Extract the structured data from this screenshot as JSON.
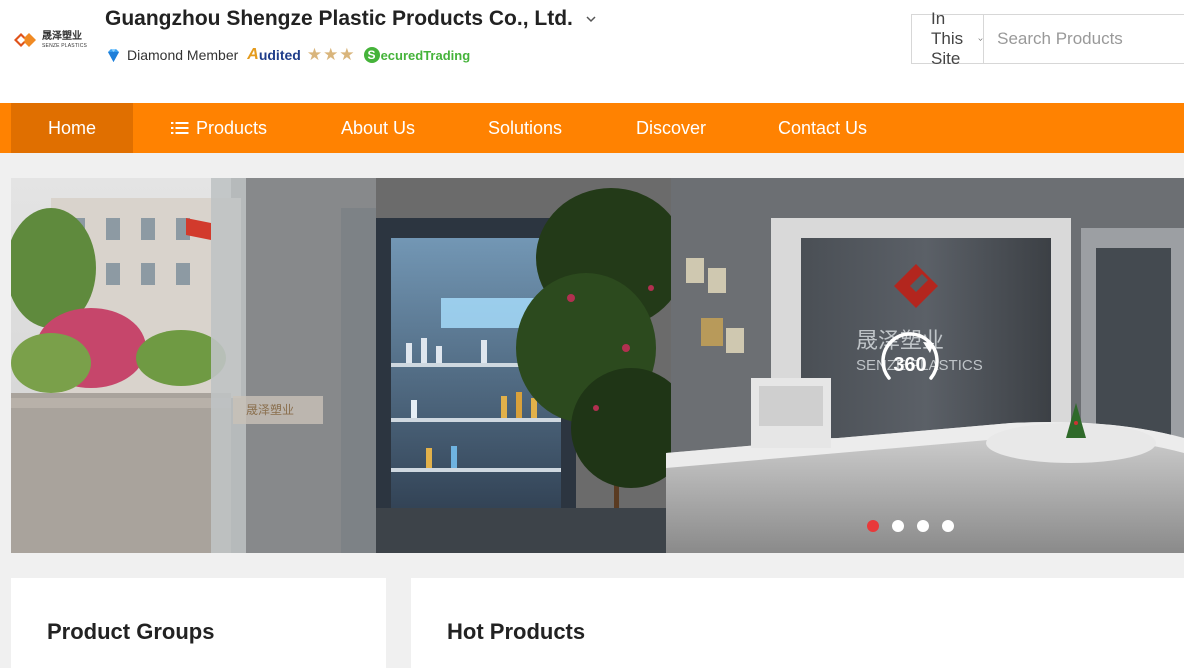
{
  "header": {
    "company_name": "Guangzhou Shengze Plastic Products Co., Ltd.",
    "logo_cn": "晟泽塑业",
    "logo_en": "SENZE PLASTICS",
    "membership": "Diamond Member",
    "audited_initial": "A",
    "audited_rest": "udited",
    "stars": "★★★",
    "secured_initial": "S",
    "secured_text": "ecuredTrading"
  },
  "search": {
    "scope": "In This Site",
    "placeholder": "Search Products"
  },
  "nav": {
    "items": [
      {
        "label": "Home"
      },
      {
        "label": "Products"
      },
      {
        "label": "About Us"
      },
      {
        "label": "Solutions"
      },
      {
        "label": "Discover"
      },
      {
        "label": "Contact Us"
      }
    ]
  },
  "banner": {
    "pano_label": "360",
    "sign_cn": "晟泽塑业",
    "sign_en": "SENZE PLASTICS",
    "door_text": "晟泽塑业",
    "slide_count": 4,
    "active_slide": 1
  },
  "sections": {
    "product_groups": "Product Groups",
    "hot_products": "Hot Products"
  },
  "colors": {
    "nav_bg": "#ff8201",
    "nav_active": "#e06f00",
    "dot_active": "#e8393a",
    "secured_green": "#45b33a",
    "audited_blue": "#1f3d8a"
  }
}
